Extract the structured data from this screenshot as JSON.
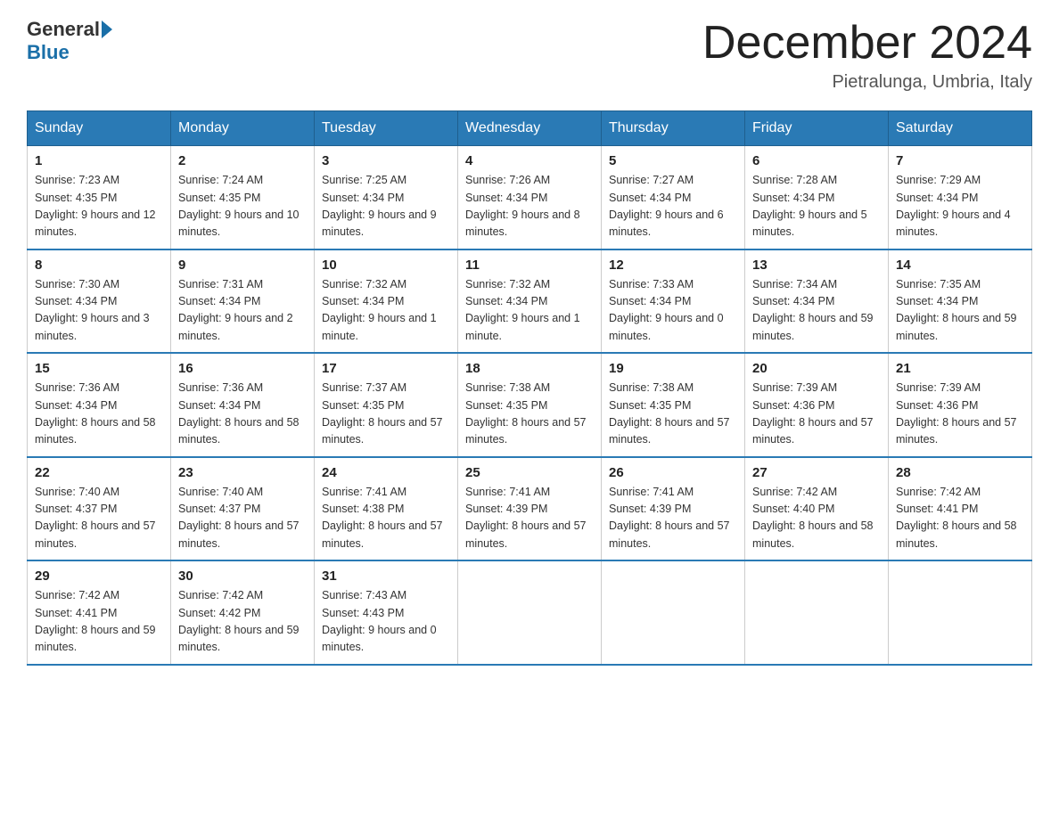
{
  "header": {
    "logo_general": "General",
    "logo_blue": "Blue",
    "month_title": "December 2024",
    "subtitle": "Pietralunga, Umbria, Italy"
  },
  "days_of_week": [
    "Sunday",
    "Monday",
    "Tuesday",
    "Wednesday",
    "Thursday",
    "Friday",
    "Saturday"
  ],
  "weeks": [
    [
      {
        "day": "1",
        "sunrise": "7:23 AM",
        "sunset": "4:35 PM",
        "daylight": "9 hours and 12 minutes."
      },
      {
        "day": "2",
        "sunrise": "7:24 AM",
        "sunset": "4:35 PM",
        "daylight": "9 hours and 10 minutes."
      },
      {
        "day": "3",
        "sunrise": "7:25 AM",
        "sunset": "4:34 PM",
        "daylight": "9 hours and 9 minutes."
      },
      {
        "day": "4",
        "sunrise": "7:26 AM",
        "sunset": "4:34 PM",
        "daylight": "9 hours and 8 minutes."
      },
      {
        "day": "5",
        "sunrise": "7:27 AM",
        "sunset": "4:34 PM",
        "daylight": "9 hours and 6 minutes."
      },
      {
        "day": "6",
        "sunrise": "7:28 AM",
        "sunset": "4:34 PM",
        "daylight": "9 hours and 5 minutes."
      },
      {
        "day": "7",
        "sunrise": "7:29 AM",
        "sunset": "4:34 PM",
        "daylight": "9 hours and 4 minutes."
      }
    ],
    [
      {
        "day": "8",
        "sunrise": "7:30 AM",
        "sunset": "4:34 PM",
        "daylight": "9 hours and 3 minutes."
      },
      {
        "day": "9",
        "sunrise": "7:31 AM",
        "sunset": "4:34 PM",
        "daylight": "9 hours and 2 minutes."
      },
      {
        "day": "10",
        "sunrise": "7:32 AM",
        "sunset": "4:34 PM",
        "daylight": "9 hours and 1 minute."
      },
      {
        "day": "11",
        "sunrise": "7:32 AM",
        "sunset": "4:34 PM",
        "daylight": "9 hours and 1 minute."
      },
      {
        "day": "12",
        "sunrise": "7:33 AM",
        "sunset": "4:34 PM",
        "daylight": "9 hours and 0 minutes."
      },
      {
        "day": "13",
        "sunrise": "7:34 AM",
        "sunset": "4:34 PM",
        "daylight": "8 hours and 59 minutes."
      },
      {
        "day": "14",
        "sunrise": "7:35 AM",
        "sunset": "4:34 PM",
        "daylight": "8 hours and 59 minutes."
      }
    ],
    [
      {
        "day": "15",
        "sunrise": "7:36 AM",
        "sunset": "4:34 PM",
        "daylight": "8 hours and 58 minutes."
      },
      {
        "day": "16",
        "sunrise": "7:36 AM",
        "sunset": "4:34 PM",
        "daylight": "8 hours and 58 minutes."
      },
      {
        "day": "17",
        "sunrise": "7:37 AM",
        "sunset": "4:35 PM",
        "daylight": "8 hours and 57 minutes."
      },
      {
        "day": "18",
        "sunrise": "7:38 AM",
        "sunset": "4:35 PM",
        "daylight": "8 hours and 57 minutes."
      },
      {
        "day": "19",
        "sunrise": "7:38 AM",
        "sunset": "4:35 PM",
        "daylight": "8 hours and 57 minutes."
      },
      {
        "day": "20",
        "sunrise": "7:39 AM",
        "sunset": "4:36 PM",
        "daylight": "8 hours and 57 minutes."
      },
      {
        "day": "21",
        "sunrise": "7:39 AM",
        "sunset": "4:36 PM",
        "daylight": "8 hours and 57 minutes."
      }
    ],
    [
      {
        "day": "22",
        "sunrise": "7:40 AM",
        "sunset": "4:37 PM",
        "daylight": "8 hours and 57 minutes."
      },
      {
        "day": "23",
        "sunrise": "7:40 AM",
        "sunset": "4:37 PM",
        "daylight": "8 hours and 57 minutes."
      },
      {
        "day": "24",
        "sunrise": "7:41 AM",
        "sunset": "4:38 PM",
        "daylight": "8 hours and 57 minutes."
      },
      {
        "day": "25",
        "sunrise": "7:41 AM",
        "sunset": "4:39 PM",
        "daylight": "8 hours and 57 minutes."
      },
      {
        "day": "26",
        "sunrise": "7:41 AM",
        "sunset": "4:39 PM",
        "daylight": "8 hours and 57 minutes."
      },
      {
        "day": "27",
        "sunrise": "7:42 AM",
        "sunset": "4:40 PM",
        "daylight": "8 hours and 58 minutes."
      },
      {
        "day": "28",
        "sunrise": "7:42 AM",
        "sunset": "4:41 PM",
        "daylight": "8 hours and 58 minutes."
      }
    ],
    [
      {
        "day": "29",
        "sunrise": "7:42 AM",
        "sunset": "4:41 PM",
        "daylight": "8 hours and 59 minutes."
      },
      {
        "day": "30",
        "sunrise": "7:42 AM",
        "sunset": "4:42 PM",
        "daylight": "8 hours and 59 minutes."
      },
      {
        "day": "31",
        "sunrise": "7:43 AM",
        "sunset": "4:43 PM",
        "daylight": "9 hours and 0 minutes."
      },
      null,
      null,
      null,
      null
    ]
  ],
  "labels": {
    "sunrise": "Sunrise:",
    "sunset": "Sunset:",
    "daylight": "Daylight:"
  }
}
